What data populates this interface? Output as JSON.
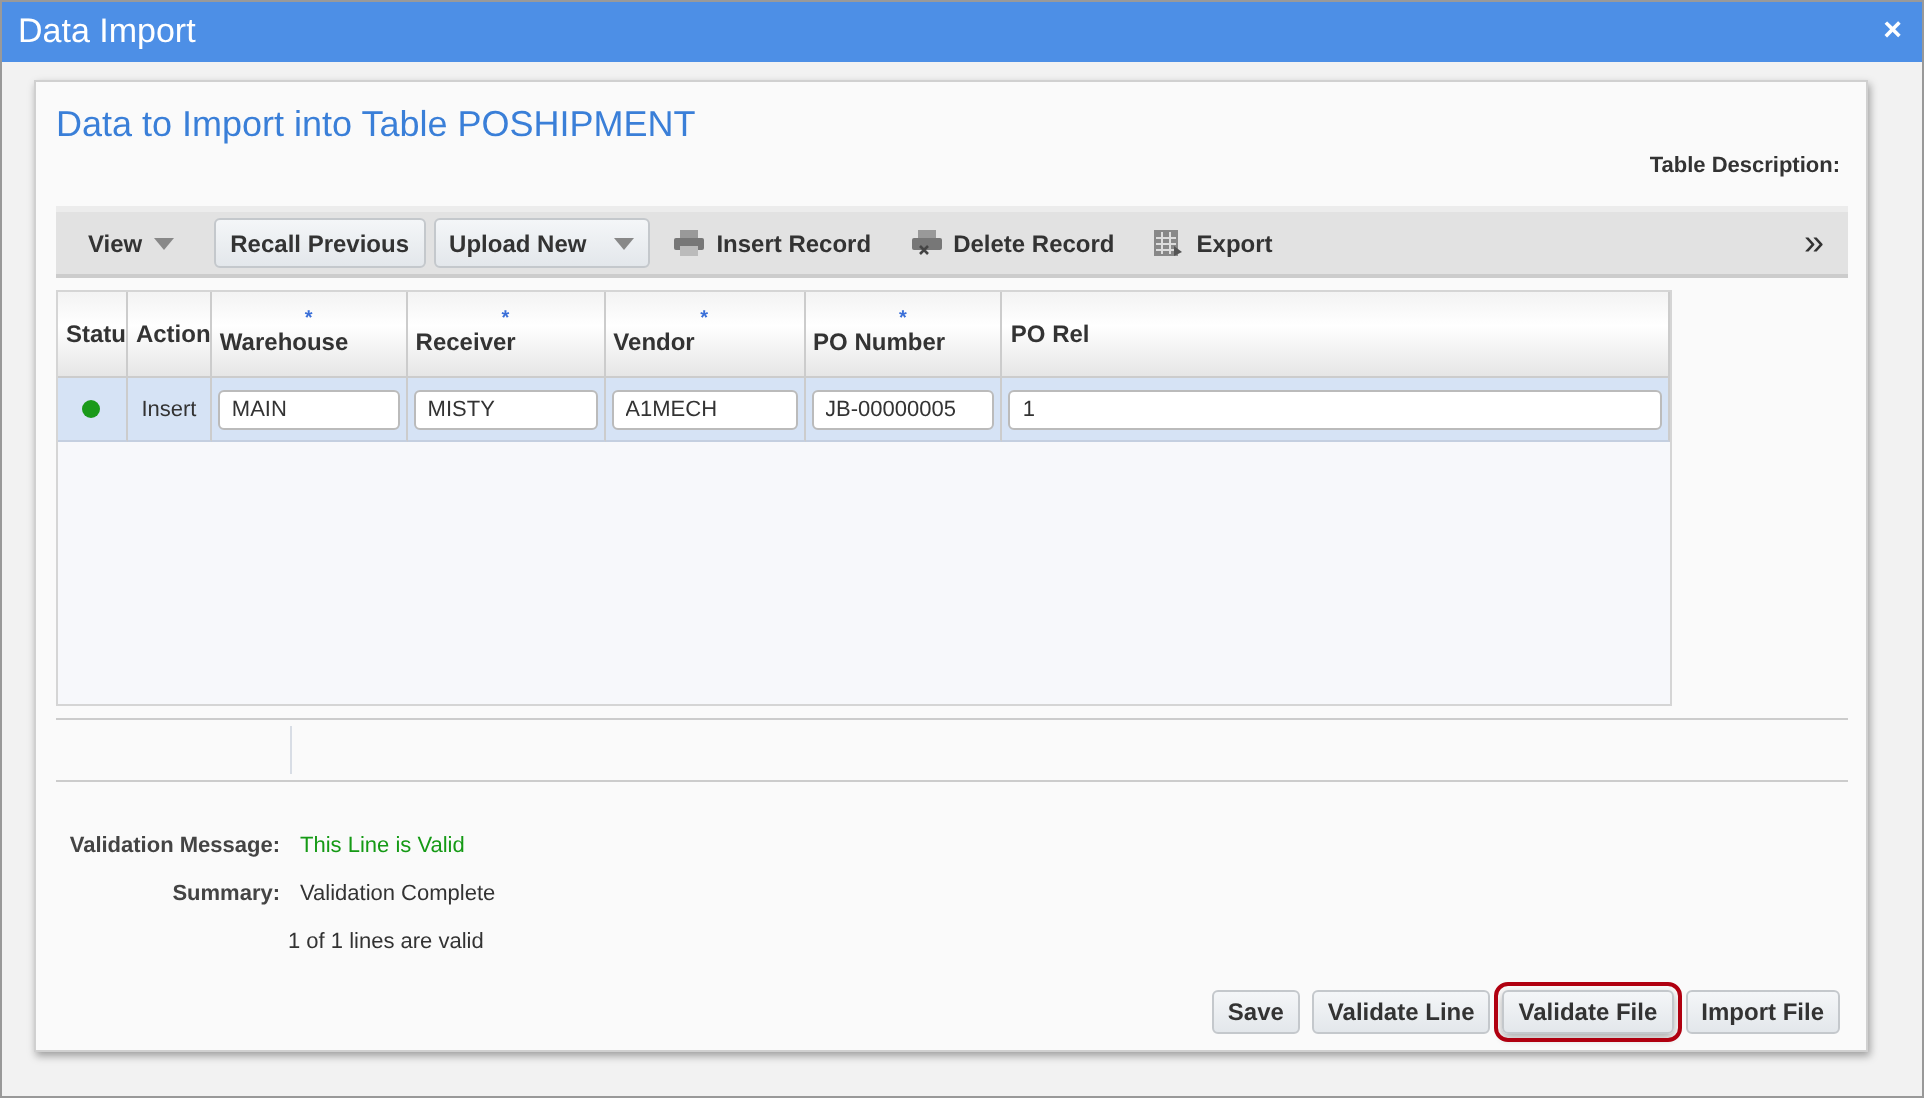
{
  "window": {
    "title": "Data Import",
    "close": "×"
  },
  "panel": {
    "title": "Data to Import into Table POSHIPMENT",
    "description_label": "Table Description:"
  },
  "toolbar": {
    "view": "View",
    "items": [
      {
        "kind": "button",
        "label": "Recall Previous"
      },
      {
        "kind": "dropdown",
        "label": "Upload New"
      },
      {
        "kind": "action",
        "label": "Insert Record"
      },
      {
        "kind": "action",
        "label": "Delete Record"
      },
      {
        "kind": "action",
        "label": "Export"
      }
    ],
    "overflow": "»"
  },
  "table": {
    "columns": [
      {
        "label": "Statu"
      },
      {
        "label": "Action"
      },
      {
        "label": "Warehouse",
        "marker": "*"
      },
      {
        "label": "Receiver",
        "marker": "*"
      },
      {
        "label": "Vendor",
        "marker": "*"
      },
      {
        "label": "PO Number",
        "marker": "*"
      },
      {
        "label": "PO Rel"
      }
    ],
    "rows": [
      {
        "selected": true,
        "color": "#1a9a1a",
        "action": "Insert",
        "values": [
          "MAIN",
          "MISTY",
          "A1MECH",
          "JB-00000005",
          "1"
        ]
      }
    ]
  },
  "validation": {
    "message_label": "Validation Message:",
    "message": "This Line is Valid",
    "summary_label": "Summary:",
    "summary": "Validation Complete",
    "count": "1 of 1 lines are valid"
  },
  "buttons": [
    {
      "label": "Save",
      "highlighted": false
    },
    {
      "label": "Validate Line",
      "highlighted": false
    },
    {
      "label": "Validate File",
      "highlighted": true
    },
    {
      "label": "Import File",
      "highlighted": false
    }
  ]
}
